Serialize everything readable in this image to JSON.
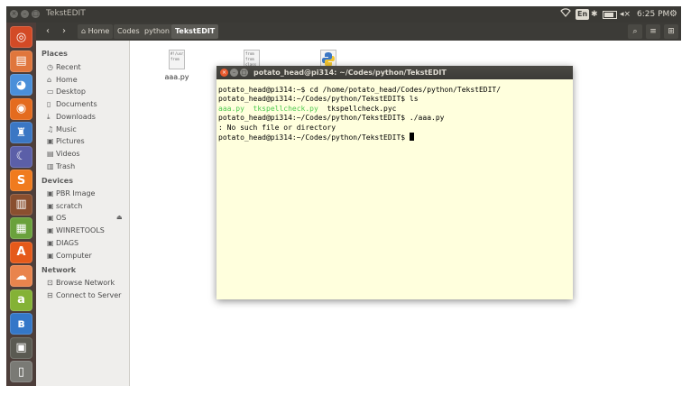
{
  "top_panel": {
    "title": "TekstEDIT",
    "keyboard": "En",
    "volume_glyph": "◂×",
    "time": "6:25 PM",
    "battery_level": 0.8
  },
  "launcher": {
    "items": [
      {
        "name": "dash-icon",
        "glyph": "◎",
        "color": "#d34a26"
      },
      {
        "name": "files-icon",
        "glyph": "▤",
        "color": "#e0763c"
      },
      {
        "name": "chromium-icon",
        "glyph": "◕",
        "color": "#4a8fd9"
      },
      {
        "name": "firefox-icon",
        "glyph": "◉",
        "color": "#e46b1e"
      },
      {
        "name": "python-icon",
        "glyph": "♜",
        "color": "#3b77c4"
      },
      {
        "name": "eclipse-icon",
        "glyph": "☾",
        "color": "#5b5fa8"
      },
      {
        "name": "sublime-icon",
        "glyph": "S",
        "color": "#f07b1e"
      },
      {
        "name": "bookshelf-icon",
        "glyph": "▥",
        "color": "#8a4f2f"
      },
      {
        "name": "apps-icon",
        "glyph": "▦",
        "color": "#6aa13c"
      },
      {
        "name": "installer-icon",
        "glyph": "A",
        "color": "#e55a1a"
      },
      {
        "name": "ubuntu-one-icon",
        "glyph": "☁",
        "color": "#e9844d"
      },
      {
        "name": "android-icon",
        "glyph": "a",
        "color": "#84b236"
      },
      {
        "name": "bluetooth-icon",
        "glyph": "ʙ",
        "color": "#3477c8"
      },
      {
        "name": "terminal-icon",
        "glyph": "▣",
        "color": "#5a5a52"
      },
      {
        "name": "trash-icon",
        "glyph": "▯",
        "color": "#7a7a75"
      }
    ]
  },
  "toolbar": {
    "back": "‹",
    "forward": "›",
    "breadcrumbs": [
      "Home",
      "Codes",
      "python",
      "TekstEDIT"
    ],
    "home_glyph": "⌂",
    "search": "⌕",
    "menu": "≡",
    "grid": "⊞"
  },
  "sidebar": {
    "places_heading": "Places",
    "places": [
      {
        "label": "Recent",
        "icon": "◷"
      },
      {
        "label": "Home",
        "icon": "⌂"
      },
      {
        "label": "Desktop",
        "icon": "▭"
      },
      {
        "label": "Documents",
        "icon": "▯"
      },
      {
        "label": "Downloads",
        "icon": "⤓"
      },
      {
        "label": "Music",
        "icon": "♫"
      },
      {
        "label": "Pictures",
        "icon": "▣"
      },
      {
        "label": "Videos",
        "icon": "▤"
      },
      {
        "label": "Trash",
        "icon": "▥"
      }
    ],
    "devices_heading": "Devices",
    "devices": [
      {
        "label": "PBR Image",
        "icon": "▣"
      },
      {
        "label": "scratch",
        "icon": "▣"
      },
      {
        "label": "OS",
        "icon": "▣"
      },
      {
        "label": "WINRETOOLS",
        "icon": "▣"
      },
      {
        "label": "DIAGS",
        "icon": "▣"
      },
      {
        "label": "Computer",
        "icon": "▣"
      }
    ],
    "network_heading": "Network",
    "network": [
      {
        "label": "Browse Network",
        "icon": "⊡"
      },
      {
        "label": "Connect to Server",
        "icon": "⊟"
      }
    ],
    "eject_glyph": "⏏"
  },
  "files": [
    {
      "name": "aaa.py",
      "preview": [
        "#!/usr/",
        "",
        "from"
      ]
    },
    {
      "name": "",
      "preview": [
        "from",
        "from",
        "class"
      ]
    },
    {
      "name": "",
      "preview": []
    }
  ],
  "terminal": {
    "title": "potato_head@pi314: ~/Codes/python/TekstEDIT",
    "lines": [
      {
        "prompt": "potato_head@pi314:~$",
        "text": " cd /home/potato_head/Codes/python/TekstEDIT/"
      },
      {
        "prompt": "potato_head@pi314:~/Codes/python/TekstEDIT$",
        "text": " ls"
      },
      {
        "ls": [
          "aaa.py",
          "tkspellcheck.py",
          "tkspellcheck.pyc"
        ]
      },
      {
        "prompt": "potato_head@pi314:~/Codes/python/TekstEDIT$",
        "text": " ./aaa.py"
      },
      {
        "prompt": "",
        "text": ": No such file or directory"
      },
      {
        "prompt": "potato_head@pi314:~/Codes/python/TekstEDIT$",
        "text": " "
      }
    ]
  }
}
